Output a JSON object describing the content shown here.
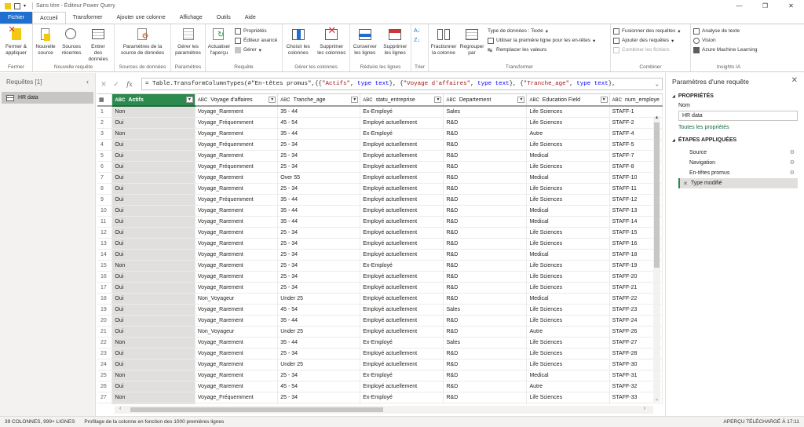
{
  "titlebar": {
    "title": "Sans titre - Éditeur Power Query",
    "minimize": "—",
    "restore": "❐",
    "close": "✕"
  },
  "tabs": [
    "Fichier",
    "Accueil",
    "Transformer",
    "Ajouter une colonne",
    "Affichage",
    "Outils",
    "Aide"
  ],
  "ribbon": {
    "fermer": {
      "btn": "Fermer & appliquer",
      "label": "Fermer"
    },
    "nouvelle": {
      "btn1": "Nouvelle source",
      "btn2": "Sources récentes",
      "btn3": "Entrer des données",
      "label": "Nouvelle requête"
    },
    "sources": {
      "btn": "Paramètres de la source de données",
      "label": "Sources de données"
    },
    "parametres": {
      "btn": "Gérer les paramètres",
      "label": "Paramètres"
    },
    "requete": {
      "btn": "Actualiser l'aperçu",
      "s1": "Propriétés",
      "s2": "Éditeur avancé",
      "s3": "Gérer",
      "label": "Requête"
    },
    "colonnes": {
      "btn1": "Choisir les colonnes",
      "btn2": "Supprimer les colonnes",
      "label": "Gérer les colonnes"
    },
    "lignes": {
      "btn1": "Conserver les lignes",
      "btn2": "Supprimer les lignes",
      "label": "Réduire les lignes"
    },
    "trier": {
      "label": "Trier"
    },
    "transformer": {
      "btn1": "Fractionner la colonne",
      "btn2": "Regrouper par",
      "s1": "Type de données : Texte",
      "s2": "Utiliser la première ligne pour les en-têtes",
      "s3": "Remplacer les valeurs",
      "label": "Transformer"
    },
    "combiner": {
      "s1": "Fusionner des requêtes",
      "s2": "Ajouter des requêtes",
      "s3": "Combiner les fichiers",
      "label": "Combiner"
    },
    "ia": {
      "s1": "Analyse de texte",
      "s2": "Vision",
      "s3": "Azure Machine Learning",
      "label": "Insights IA"
    }
  },
  "queries": {
    "header": "Requêtes [1]",
    "items": [
      "HR data"
    ]
  },
  "formula": {
    "prefix": "= Table.TransformColumnTypes(#\"En-têtes promus\",{{",
    "p1": "\"Actifs\"",
    "t1": "type text",
    "p2": "\"Voyage d'affaires\"",
    "t2": "type text",
    "p3": "\"Tranche_age\"",
    "t3": "type text"
  },
  "grid": {
    "columns": [
      "Actifs",
      "Voyage d'affaires",
      "Tranche_age",
      "statu_entreprise",
      "Departement",
      "Education Field",
      "num_employe"
    ],
    "type_label": "ABC",
    "rows": [
      [
        "1",
        "Non",
        "Voyage_Rarement",
        "35 - 44",
        "Ex-Employé",
        "Sales",
        "Life Sciences",
        "STAFF-1"
      ],
      [
        "2",
        "Oui",
        "Voyage_Fréquemment",
        "45 - 54",
        "Employé actuellement",
        "R&D",
        "Life Sciences",
        "STAFF-2"
      ],
      [
        "3",
        "Non",
        "Voyage_Rarement",
        "35 - 44",
        "Ex-Employé",
        "R&D",
        "Autre",
        "STAFF-4"
      ],
      [
        "4",
        "Oui",
        "Voyage_Fréquemment",
        "25 - 34",
        "Employé actuellement",
        "R&D",
        "Life Sciences",
        "STAFF-5"
      ],
      [
        "5",
        "Oui",
        "Voyage_Rarement",
        "25 - 34",
        "Employé actuellement",
        "R&D",
        "Medical",
        "STAFF-7"
      ],
      [
        "6",
        "Oui",
        "Voyage_Fréquemment",
        "25 - 34",
        "Employé actuellement",
        "R&D",
        "Life Sciences",
        "STAFF-8"
      ],
      [
        "7",
        "Oui",
        "Voyage_Rarement",
        "Over 55",
        "Employé actuellement",
        "R&D",
        "Medical",
        "STAFF-10"
      ],
      [
        "8",
        "Oui",
        "Voyage_Rarement",
        "25 - 34",
        "Employé actuellement",
        "R&D",
        "Life Sciences",
        "STAFF-11"
      ],
      [
        "9",
        "Oui",
        "Voyage_Fréquemment",
        "35 - 44",
        "Employé actuellement",
        "R&D",
        "Life Sciences",
        "STAFF-12"
      ],
      [
        "10",
        "Oui",
        "Voyage_Rarement",
        "35 - 44",
        "Employé actuellement",
        "R&D",
        "Medical",
        "STAFF-13"
      ],
      [
        "11",
        "Oui",
        "Voyage_Rarement",
        "35 - 44",
        "Employé actuellement",
        "R&D",
        "Medical",
        "STAFF-14"
      ],
      [
        "12",
        "Oui",
        "Voyage_Rarement",
        "25 - 34",
        "Employé actuellement",
        "R&D",
        "Life Sciences",
        "STAFF-15"
      ],
      [
        "13",
        "Oui",
        "Voyage_Rarement",
        "25 - 34",
        "Employé actuellement",
        "R&D",
        "Life Sciences",
        "STAFF-16"
      ],
      [
        "14",
        "Oui",
        "Voyage_Rarement",
        "25 - 34",
        "Employé actuellement",
        "R&D",
        "Medical",
        "STAFF-18"
      ],
      [
        "15",
        "Non",
        "Voyage_Rarement",
        "25 - 34",
        "Ex-Employé",
        "R&D",
        "Life Sciences",
        "STAFF-19"
      ],
      [
        "16",
        "Oui",
        "Voyage_Rarement",
        "25 - 34",
        "Employé actuellement",
        "R&D",
        "Life Sciences",
        "STAFF-20"
      ],
      [
        "17",
        "Oui",
        "Voyage_Rarement",
        "25 - 34",
        "Employé actuellement",
        "R&D",
        "Life Sciences",
        "STAFF-21"
      ],
      [
        "18",
        "Oui",
        "Non_Voyageur",
        "Under 25",
        "Employé actuellement",
        "R&D",
        "Medical",
        "STAFF-22"
      ],
      [
        "19",
        "Oui",
        "Voyage_Rarement",
        "45 - 54",
        "Employé actuellement",
        "Sales",
        "Life Sciences",
        "STAFF-23"
      ],
      [
        "20",
        "Oui",
        "Voyage_Rarement",
        "35 - 44",
        "Employé actuellement",
        "R&D",
        "Life Sciences",
        "STAFF-24"
      ],
      [
        "21",
        "Oui",
        "Non_Voyageur",
        "Under 25",
        "Employé actuellement",
        "R&D",
        "Autre",
        "STAFF-26"
      ],
      [
        "22",
        "Non",
        "Voyage_Rarement",
        "35 - 44",
        "Ex-Employé",
        "Sales",
        "Life Sciences",
        "STAFF-27"
      ],
      [
        "23",
        "Oui",
        "Voyage_Rarement",
        "25 - 34",
        "Employé actuellement",
        "R&D",
        "Life Sciences",
        "STAFF-28"
      ],
      [
        "24",
        "Oui",
        "Voyage_Rarement",
        "Under 25",
        "Employé actuellement",
        "R&D",
        "Life Sciences",
        "STAFF-30"
      ],
      [
        "25",
        "Non",
        "Voyage_Rarement",
        "25 - 34",
        "Ex-Employé",
        "R&D",
        "Medical",
        "STAFF-31"
      ],
      [
        "26",
        "Oui",
        "Voyage_Rarement",
        "45 - 54",
        "Employé actuellement",
        "R&D",
        "Autre",
        "STAFF-32"
      ],
      [
        "27",
        "Non",
        "Voyage_Fréquemment",
        "25 - 34",
        "Ex-Employé",
        "R&D",
        "Life Sciences",
        "STAFF-33"
      ],
      [
        "28",
        "",
        "",
        "",
        "",
        "",
        "",
        ""
      ]
    ]
  },
  "settings": {
    "title": "Paramètres d'une requête",
    "props_header": "PROPRIÉTÉS",
    "name_label": "Nom",
    "name_value": "HR data",
    "all_props": "Toutes les propriétés",
    "steps_header": "ÉTAPES APPLIQUÉES",
    "steps": [
      "Source",
      "Navigation",
      "En-têtes promus",
      "Type modifié"
    ]
  },
  "status": {
    "left1": "39 COLONNES, 999+ LIGNES",
    "left2": "Profilage de la colonne en fonction des 1000 premières lignes",
    "right": "APERÇU TÉLÉCHARGÉ À 17:11"
  },
  "colors": {
    "file_tab": "#1f6fd0",
    "selected_col": "#2d8a4e",
    "accent_line": "#1b9e77"
  }
}
